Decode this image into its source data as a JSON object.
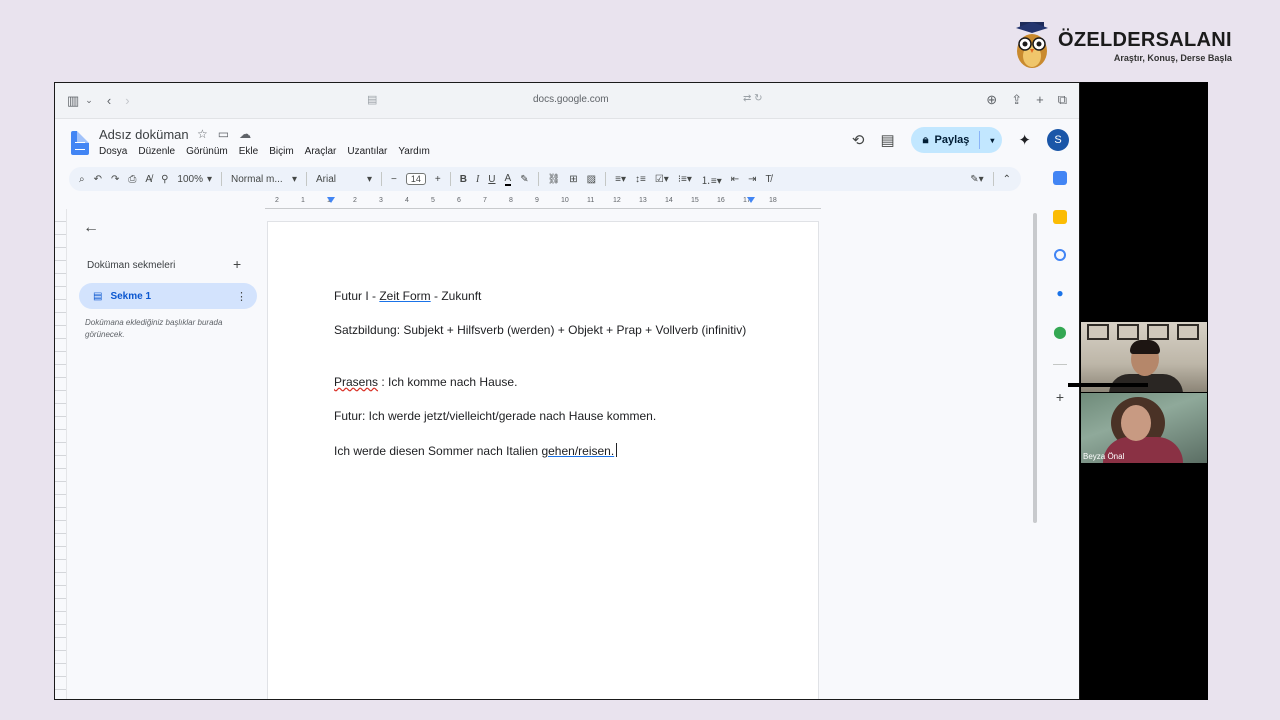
{
  "brand": {
    "name": "ÖZELDERSALANI",
    "tagline": "Araştır, Konuş, Derse Başla"
  },
  "browser": {
    "url": "docs.google.com"
  },
  "doc": {
    "title": "Adsız doküman",
    "menus": [
      "Dosya",
      "Düzenle",
      "Görünüm",
      "Ekle",
      "Biçim",
      "Araçlar",
      "Uzantılar",
      "Yardım"
    ],
    "share_label": "Paylaş",
    "account_initial": "S"
  },
  "toolbar": {
    "zoom": "100%",
    "style": "Normal m...",
    "font": "Arial",
    "font_size": "14"
  },
  "ruler": {
    "ticks": [
      "2",
      "1",
      "1",
      "2",
      "3",
      "4",
      "5",
      "6",
      "7",
      "8",
      "9",
      "10",
      "11",
      "12",
      "13",
      "14",
      "15",
      "16",
      "17",
      "18"
    ]
  },
  "sidebar": {
    "heading": "Doküman sekmeleri",
    "tab_label": "Sekme 1",
    "hint": "Dokümana eklediğiniz başlıklar burada görünecek."
  },
  "document": {
    "line1_a": "Futur I - ",
    "line1_b": "Zeit Form",
    "line1_c": " - Zukunft",
    "line2": "Satzbildung: Subjekt + Hilfsverb (werden) + Objekt + Prap + Vollverb (infinitiv)",
    "line3_a": "Prasens",
    "line3_b": " : Ich komme nach Hause.",
    "line4": "Futur: Ich werde jetzt/vielleicht/gerade nach Hause kommen.",
    "line5_a": "Ich werde diesen Sommer nach Italien ",
    "line5_b": "gehen/reisen."
  },
  "video": {
    "participant2_name": "Beyza Önal"
  },
  "icons": {
    "sidebar_toggle": "sidebar-icon",
    "back": "arrow-left-icon",
    "forward": "arrow-right-icon",
    "history": "history-icon",
    "comments": "comment-icon",
    "lock": "lock-icon",
    "gemini": "sparkle-icon"
  },
  "colors": {
    "share_bg": "#c2e7ff",
    "tab_bg": "#d3e3fd",
    "avatar_bg": "#1a56a8",
    "doc_icon": "#4285f4"
  }
}
